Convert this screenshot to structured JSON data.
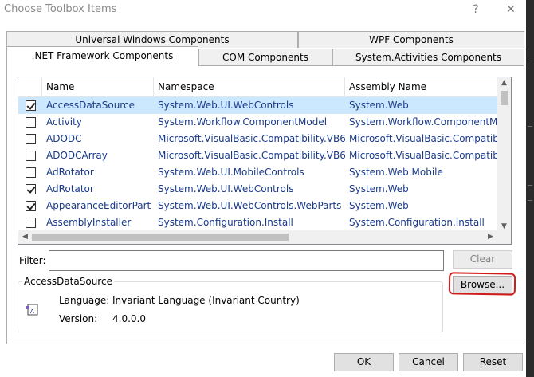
{
  "window": {
    "title": "Choose Toolbox Items",
    "help_btn": "?",
    "close_btn": "✕"
  },
  "tabs": {
    "row1": [
      "Universal Windows Components",
      "WPF Components"
    ],
    "row2": [
      ".NET Framework Components",
      "COM Components",
      "System.Activities Components"
    ]
  },
  "list": {
    "columns": [
      "Name",
      "Namespace",
      "Assembly Name"
    ],
    "rows": [
      {
        "checked": true,
        "name": "AccessDataSource",
        "namespace": "System.Web.UI.WebControls",
        "assembly": "System.Web",
        "selected": true
      },
      {
        "checked": false,
        "name": "Activity",
        "namespace": "System.Workflow.ComponentModel",
        "assembly": "System.Workflow.ComponentMo"
      },
      {
        "checked": false,
        "name": "ADODC",
        "namespace": "Microsoft.VisualBasic.Compatibility.VB6",
        "assembly": "Microsoft.VisualBasic.Compatibi"
      },
      {
        "checked": false,
        "name": "ADODCArray",
        "namespace": "Microsoft.VisualBasic.Compatibility.VB6",
        "assembly": "Microsoft.VisualBasic.Compatibi"
      },
      {
        "checked": false,
        "name": "AdRotator",
        "namespace": "System.Web.UI.MobileControls",
        "assembly": "System.Web.Mobile"
      },
      {
        "checked": true,
        "name": "AdRotator",
        "namespace": "System.Web.UI.WebControls",
        "assembly": "System.Web"
      },
      {
        "checked": true,
        "name": "AppearanceEditorPart",
        "namespace": "System.Web.UI.WebControls.WebParts",
        "assembly": "System.Web"
      },
      {
        "checked": false,
        "name": "AssemblyInstaller",
        "namespace": "System.Configuration.Install",
        "assembly": "System.Configuration.Install"
      }
    ]
  },
  "filter": {
    "label": "Filter:",
    "value": "",
    "clear": "Clear"
  },
  "details": {
    "title": "AccessDataSource",
    "language_label": "Language:",
    "language_value": "Invariant Language (Invariant Country)",
    "version_label": "Version:",
    "version_value": "4.0.0.0",
    "browse": "Browse..."
  },
  "footer": {
    "ok": "OK",
    "cancel": "Cancel",
    "reset": "Reset"
  },
  "colors": {
    "accent": "#1a3a8a",
    "selection": "#cce8ff",
    "annotation": "#d11a1a"
  }
}
